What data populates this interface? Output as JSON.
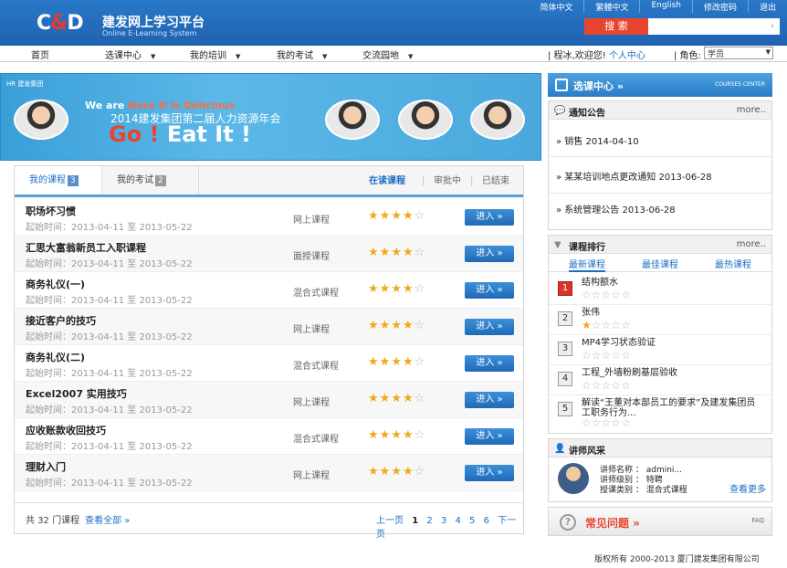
{
  "header": {
    "logo_left": "C",
    "logo_amp": "&",
    "logo_right": "D",
    "site_title": "建发网上学习平台",
    "site_subtitle": "Online E-Learning System",
    "toplinks": [
      "简体中文",
      "繁體中文",
      "English",
      "修改密码",
      "退出"
    ],
    "search_label": "搜  索",
    "search_value": ""
  },
  "nav": {
    "items": [
      "首页",
      "选课中心",
      "我的培训",
      "我的考试",
      "交流园地"
    ],
    "greeting": "| 程冰,欢迎您!",
    "personal_center": "个人中心",
    "role_label": "| 角色:",
    "role_value": "学员"
  },
  "banner": {
    "logo": "HR 建发集团",
    "we_are": "We are ",
    "here": "Here",
    "its": " It is ",
    "delicious": "Delicious",
    "subtitle": "2014建发集团第二届人力资源年会",
    "go": "Go",
    "bang": " ! ",
    "eat_it": "Eat It !"
  },
  "courses": {
    "tab_my_courses": "我的课程",
    "tab_my_courses_count": "3",
    "tab_my_exams": "我的考试",
    "tab_my_exams_count": "2",
    "filter_reading": "在读课程",
    "filter_pending": "审批中",
    "filter_done": "已结束",
    "enter_label": "进入 »",
    "rows": [
      {
        "title": "职场坏习惯",
        "time": "起始时间：2013-04-11 至 2013-05-22",
        "type": "网上课程",
        "rating": 4
      },
      {
        "title": "汇思大富翁新员工入职课程",
        "time": "起始时间：2013-04-11 至 2013-05-22",
        "type": "面授课程",
        "rating": 4
      },
      {
        "title": "商务礼仪(一)",
        "time": "起始时间：2013-04-11 至 2013-05-22",
        "type": "混合式课程",
        "rating": 4
      },
      {
        "title": "接近客户的技巧",
        "time": "起始时间：2013-04-11 至 2013-05-22",
        "type": "网上课程",
        "rating": 4
      },
      {
        "title": "商务礼仪(二)",
        "time": "起始时间：2013-04-11 至 2013-05-22",
        "type": "混合式课程",
        "rating": 4
      },
      {
        "title": "Excel2007 实用技巧",
        "time": "起始时间：2013-04-11 至 2013-05-22",
        "type": "网上课程",
        "rating": 4
      },
      {
        "title": "应收账款收回技巧",
        "time": "起始时间：2013-04-11 至 2013-05-22",
        "type": "混合式课程",
        "rating": 4
      },
      {
        "title": "理财入门",
        "time": "起始时间：2013-04-11 至 2013-05-22",
        "type": "网上课程",
        "rating": 4
      }
    ],
    "total": "共 32 门课程",
    "view_all": "查看全部 »",
    "pager_prev": "上一页",
    "pages": [
      "1",
      "2",
      "3",
      "4",
      "5",
      "6"
    ],
    "pager_next": "下一页"
  },
  "right": {
    "courses_center": "选课中心 »",
    "courses_center_en": "COURSES CENTER",
    "notice_title": "通知公告",
    "more": "more..",
    "notices": [
      "» 销售  2014-04-10",
      "» 某某培训地点更改通知  2013-06-28",
      "» 系统管理公告  2013-06-28"
    ],
    "rank_title": "课程排行",
    "rank_tabs": [
      "最新课程",
      "最佳课程",
      "最热课程"
    ],
    "ranks": [
      {
        "num": "1",
        "name": "结构额水",
        "rating": 0
      },
      {
        "num": "2",
        "name": "张伟",
        "rating": 1
      },
      {
        "num": "3",
        "name": "MP4学习状态验证",
        "rating": 0
      },
      {
        "num": "4",
        "name": "工程_外墙粉刷基层验收",
        "rating": 0
      },
      {
        "num": "5",
        "name": "解读“王董对本部员工的要求”及建发集团员工职务行为...",
        "rating": 0
      }
    ],
    "teacher_title": "讲师风采",
    "teacher_name": "讲师名称 ： admini...",
    "teacher_level": "讲师级别 ： 特聘",
    "teacher_type": "授课类别 ： 混合式课程",
    "teacher_more": "查看更多",
    "faq_title": "常见问题 »",
    "faq_tag": "FAQ"
  },
  "footer": {
    "copyright": "版权所有  2000-2013  厦门建发集团有限公司"
  }
}
